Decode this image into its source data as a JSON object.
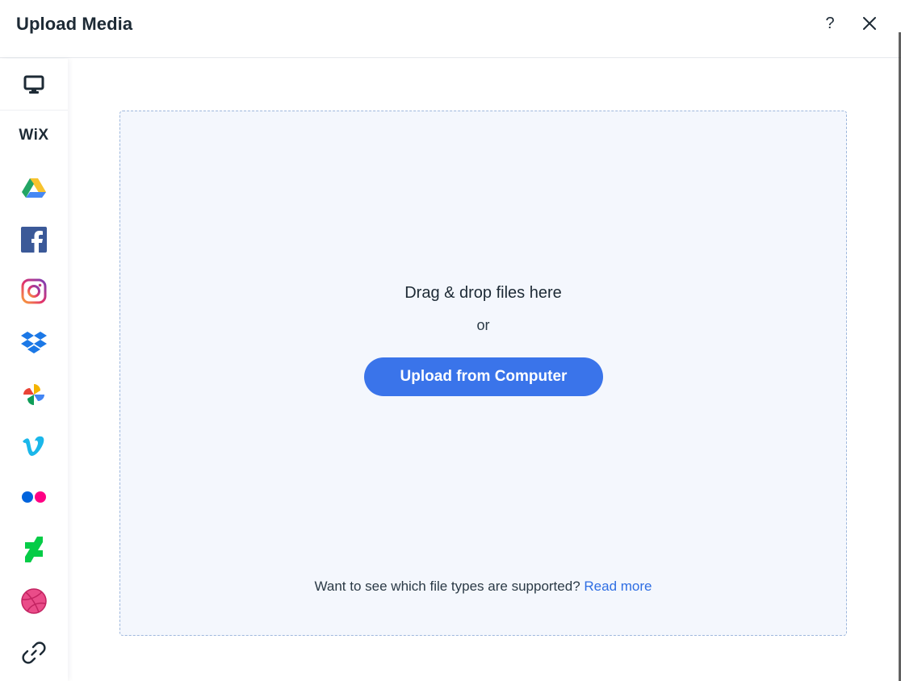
{
  "header": {
    "title": "Upload Media",
    "help_label": "?"
  },
  "sidebar": {
    "items": [
      {
        "name": "computer",
        "icon": "monitor-icon",
        "active": true
      },
      {
        "name": "wix",
        "icon": "wix-logo-icon",
        "label": "WiX"
      },
      {
        "name": "google-drive",
        "icon": "google-drive-icon"
      },
      {
        "name": "facebook",
        "icon": "facebook-icon"
      },
      {
        "name": "instagram",
        "icon": "instagram-icon"
      },
      {
        "name": "dropbox",
        "icon": "dropbox-icon"
      },
      {
        "name": "google-photos",
        "icon": "google-photos-icon"
      },
      {
        "name": "vimeo",
        "icon": "vimeo-icon"
      },
      {
        "name": "flickr",
        "icon": "flickr-icon"
      },
      {
        "name": "deviantart",
        "icon": "deviantart-icon"
      },
      {
        "name": "dribbble",
        "icon": "dribbble-icon"
      },
      {
        "name": "link",
        "icon": "link-icon"
      }
    ]
  },
  "dropzone": {
    "drag_text": "Drag & drop files here",
    "or_text": "or",
    "upload_button": "Upload from Computer",
    "footer_text": "Want to see which file types are supported?",
    "read_more": "Read more"
  },
  "colors": {
    "accent": "#3a74ea",
    "link": "#2f6ee3",
    "dropzone_bg": "#f4f7fd",
    "dropzone_border": "#9fb8dd"
  }
}
